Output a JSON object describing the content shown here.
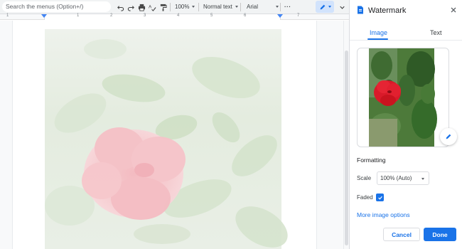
{
  "toolbar": {
    "search_placeholder": "Search the menus (Option+/)",
    "zoom": "100%",
    "style": "Normal text",
    "font": "Arial",
    "more": "···"
  },
  "ruler": {
    "numbers": [
      "1",
      "1",
      "2",
      "3",
      "4",
      "5",
      "6",
      "7"
    ]
  },
  "panel": {
    "title": "Watermark",
    "tabs": [
      {
        "label": "Image",
        "active": true
      },
      {
        "label": "Text",
        "active": false
      }
    ],
    "formatting_label": "Formatting",
    "scale_label": "Scale",
    "scale_value": "100% (Auto)",
    "faded_label": "Faded",
    "faded_checked": true,
    "more_options": "More image options",
    "cancel": "Cancel",
    "done": "Done"
  },
  "colors": {
    "accent": "#1a73e8",
    "toolbar_bg": "#f1f3f4"
  }
}
